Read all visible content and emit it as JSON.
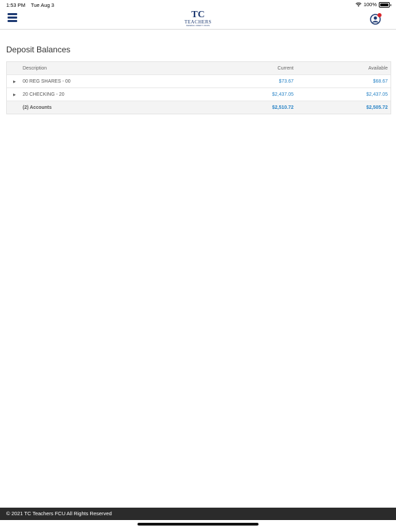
{
  "status": {
    "time": "1:53 PM",
    "date": "Tue Aug 3",
    "battery": "100%"
  },
  "header": {
    "logo_mark": "TC",
    "logo_name": "TEACHERS",
    "logo_tagline": "FEDERAL CREDIT UNION"
  },
  "page": {
    "title": "Deposit Balances"
  },
  "table": {
    "headers": {
      "description": "Description",
      "current": "Current",
      "available": "Available"
    },
    "rows": [
      {
        "description": "00 REG SHARES - 00",
        "current": "$73.67",
        "available": "$68.67"
      },
      {
        "description": "20 CHECKING - 20",
        "current": "$2,437.05",
        "available": "$2,437.05"
      }
    ],
    "total": {
      "description": "(2) Accounts",
      "current": "$2,510.72",
      "available": "$2,505.72"
    }
  },
  "footer": {
    "text": "© 2021 TC Teachers FCU All Rights Reserved"
  },
  "colors": {
    "brand": "#1f3b73",
    "link": "#2a84c6",
    "footer_bg": "#2b2b2b",
    "notify": "#d9252a"
  }
}
